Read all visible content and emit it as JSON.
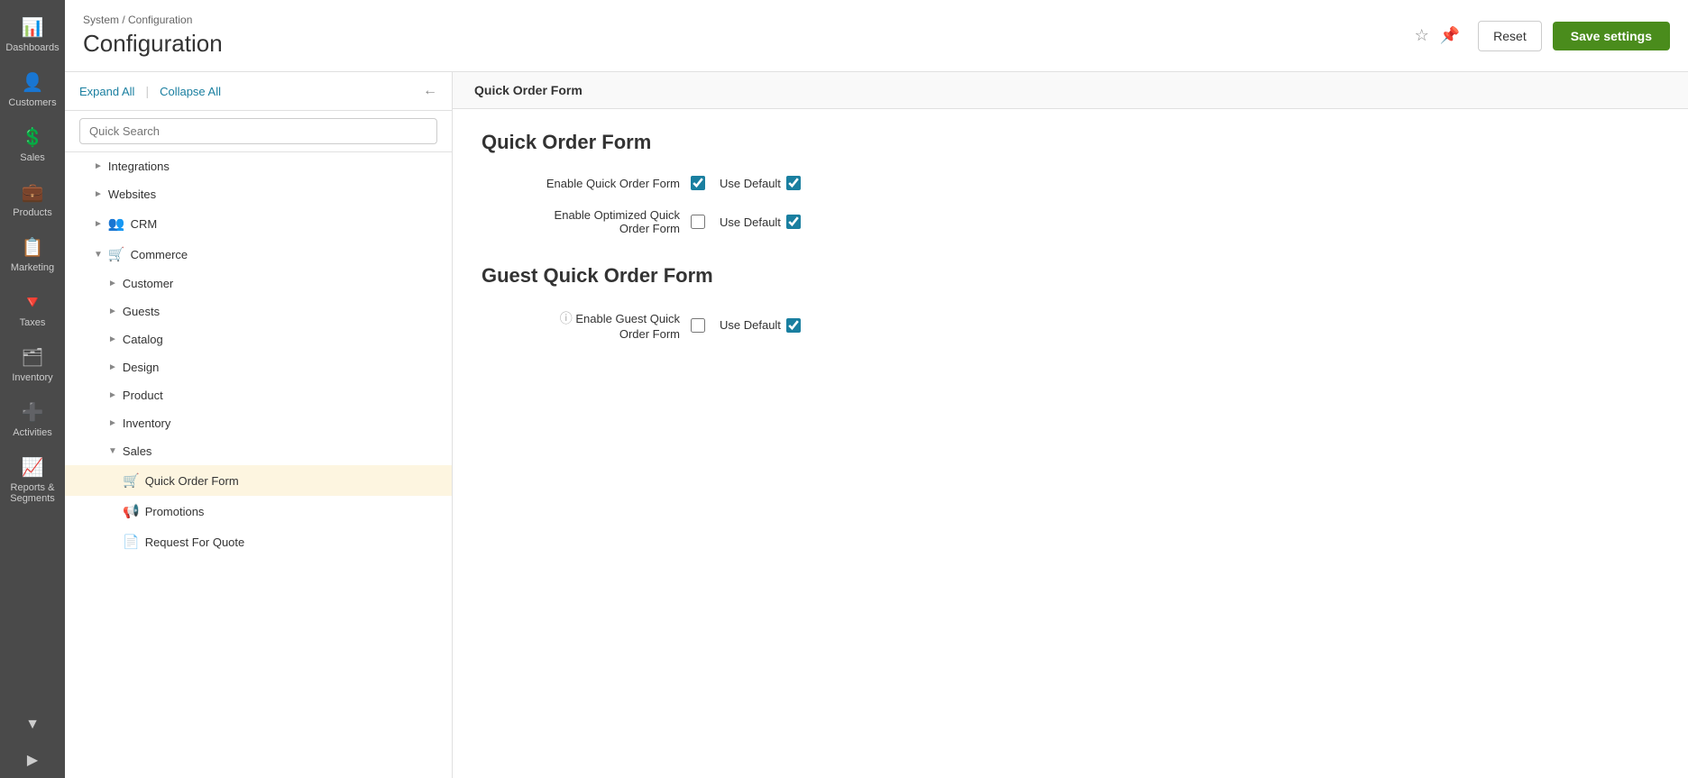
{
  "sidebar": {
    "items": [
      {
        "label": "Dashboards",
        "icon": "📊"
      },
      {
        "label": "Customers",
        "icon": "👤"
      },
      {
        "label": "Sales",
        "icon": "💲"
      },
      {
        "label": "Products",
        "icon": "💼"
      },
      {
        "label": "Marketing",
        "icon": "📋"
      },
      {
        "label": "Taxes",
        "icon": "🔻"
      },
      {
        "label": "Inventory",
        "icon": "🗂"
      },
      {
        "label": "Activities",
        "icon": "➕"
      },
      {
        "label": "Reports &\nSegments",
        "icon": "📈"
      }
    ]
  },
  "topbar": {
    "breadcrumb": "System / Configuration",
    "title": "Configuration",
    "reset_label": "Reset",
    "save_label": "Save settings"
  },
  "left_panel": {
    "expand_all": "Expand All",
    "collapse_all": "Collapse All",
    "search_placeholder": "Quick Search",
    "nav_items": [
      {
        "indent": 1,
        "type": "chevron-right",
        "label": "Integrations"
      },
      {
        "indent": 1,
        "type": "chevron-right",
        "label": "Websites"
      },
      {
        "indent": 1,
        "type": "chevron-right",
        "icon": "crm",
        "label": "CRM"
      },
      {
        "indent": 1,
        "type": "chevron-down",
        "icon": "cart",
        "label": "Commerce",
        "expanded": true
      },
      {
        "indent": 2,
        "type": "chevron-right",
        "label": "Customer"
      },
      {
        "indent": 2,
        "type": "chevron-right",
        "label": "Guests"
      },
      {
        "indent": 2,
        "type": "chevron-right",
        "label": "Catalog"
      },
      {
        "indent": 2,
        "type": "chevron-right",
        "label": "Design"
      },
      {
        "indent": 2,
        "type": "chevron-right",
        "label": "Product"
      },
      {
        "indent": 2,
        "type": "chevron-right",
        "label": "Inventory"
      },
      {
        "indent": 2,
        "type": "chevron-down",
        "label": "Sales",
        "expanded": true
      },
      {
        "indent": 3,
        "type": "active",
        "icon": "cart",
        "label": "Quick Order Form"
      },
      {
        "indent": 3,
        "type": "none",
        "icon": "promotions",
        "label": "Promotions"
      },
      {
        "indent": 3,
        "type": "none",
        "icon": "rfq",
        "label": "Request For Quote"
      }
    ]
  },
  "main_section": {
    "header": "Quick Order Form",
    "quick_order_form": {
      "title": "Quick Order Form",
      "fields": [
        {
          "label": "Enable Quick Order Form",
          "checkbox_enabled": true,
          "use_default_checked": true,
          "has_info": false
        },
        {
          "label": "Enable Optimized Quick Order Form",
          "checkbox_enabled": false,
          "use_default_checked": true,
          "has_info": false
        }
      ]
    },
    "guest_quick_order_form": {
      "title": "Guest Quick Order Form",
      "fields": [
        {
          "label": "Enable Guest Quick Order Form",
          "checkbox_enabled": false,
          "use_default_checked": true,
          "has_info": true
        }
      ]
    }
  }
}
